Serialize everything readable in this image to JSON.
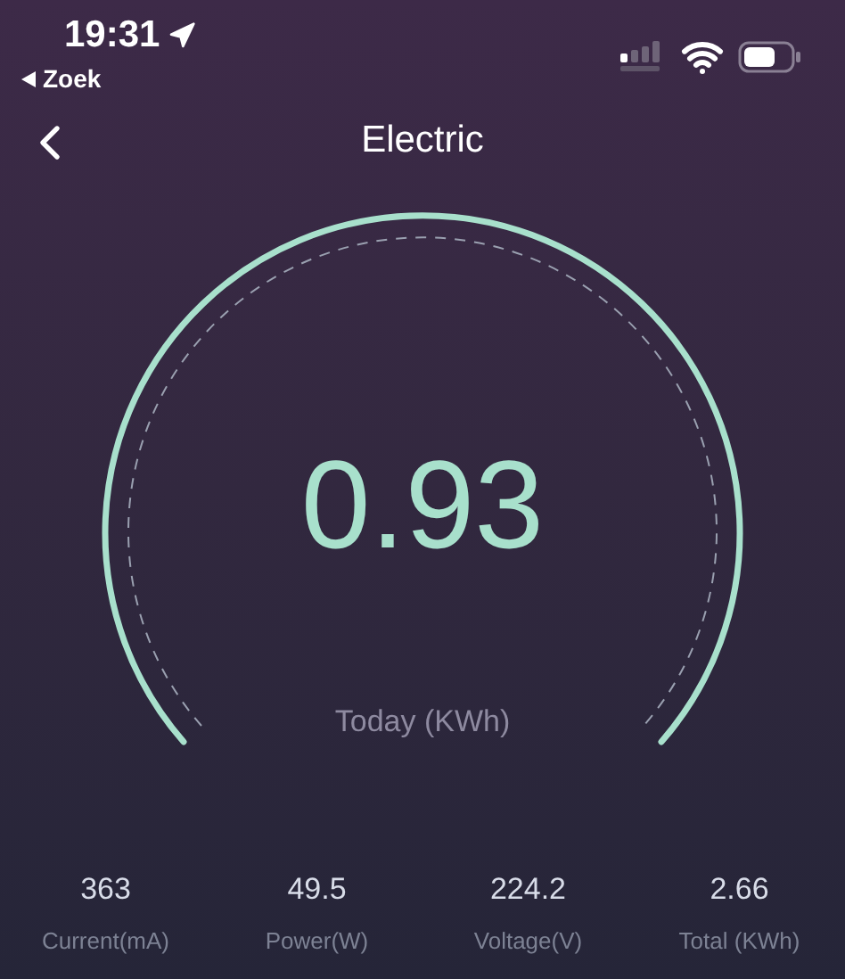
{
  "status_bar": {
    "time": "19:31",
    "back_label": "Zoek"
  },
  "nav": {
    "title": "Electric"
  },
  "gauge": {
    "value": "0.93",
    "caption": "Today (KWh)"
  },
  "stats": [
    {
      "value": "363",
      "label": "Current(mA)"
    },
    {
      "value": "49.5",
      "label": "Power(W)"
    },
    {
      "value": "224.2",
      "label": "Voltage(V)"
    },
    {
      "value": "2.66",
      "label": "Total (KWh)"
    }
  ]
}
